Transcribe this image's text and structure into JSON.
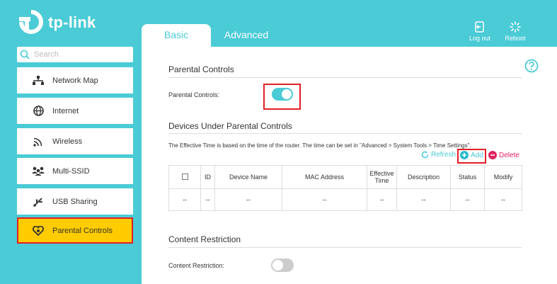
{
  "brand": {
    "name": "tp-link"
  },
  "tabs": [
    {
      "label": "Basic",
      "active": true
    },
    {
      "label": "Advanced",
      "active": false
    }
  ],
  "header": {
    "logout_label": "Log out",
    "reboot_label": "Reboot"
  },
  "search": {
    "placeholder": "Search"
  },
  "sidebar": {
    "items": [
      {
        "label": "Network Map",
        "icon": "network-map-icon"
      },
      {
        "label": "Internet",
        "icon": "globe-icon"
      },
      {
        "label": "Wireless",
        "icon": "wifi-icon"
      },
      {
        "label": "Multi-SSID",
        "icon": "multi-user-icon"
      },
      {
        "label": "USB Sharing",
        "icon": "usb-icon"
      },
      {
        "label": "Parental Controls",
        "icon": "heart-icon",
        "selected": true
      }
    ]
  },
  "main": {
    "parental": {
      "title": "Parental Controls",
      "toggle_label": "Parental Controls:",
      "enabled": true
    },
    "devices": {
      "title": "Devices Under Parental Controls",
      "note": "The Effective Time is based on the time of the router. The time can be set in \"Advanced > System Tools > Time Settings\".",
      "refresh_label": "Refresh",
      "add_label": "Add",
      "delete_label": "Delete",
      "columns": [
        "",
        "ID",
        "Device Name",
        "MAC Address",
        "Effective Time",
        "Description",
        "Status",
        "Modify"
      ],
      "row": [
        "--",
        "--",
        "--",
        "--",
        "--",
        "--",
        "--",
        "--"
      ]
    },
    "content": {
      "title": "Content Restriction",
      "toggle_label": "Content Restriction:",
      "enabled": false
    }
  },
  "colors": {
    "accent": "#4acbd6",
    "highlight": "#ffcc00",
    "alert": "#e21f26",
    "add": "#2bb9cd",
    "delete": "#e0245e"
  }
}
